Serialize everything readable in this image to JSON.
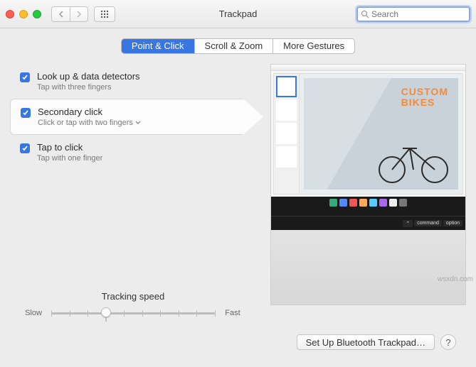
{
  "window": {
    "title": "Trackpad"
  },
  "search": {
    "placeholder": "Search"
  },
  "tabs": {
    "point_click": "Point & Click",
    "scroll_zoom": "Scroll & Zoom",
    "more_gestures": "More Gestures",
    "active": "point_click"
  },
  "options": [
    {
      "title": "Look up & data detectors",
      "subtitle": "Tap with three fingers",
      "checked": true,
      "has_dropdown": false
    },
    {
      "title": "Secondary click",
      "subtitle": "Click or tap with two fingers",
      "checked": true,
      "has_dropdown": true
    },
    {
      "title": "Tap to click",
      "subtitle": "Tap with one finger",
      "checked": true,
      "has_dropdown": false
    }
  ],
  "tracking": {
    "label": "Tracking speed",
    "min_label": "Slow",
    "max_label": "Fast",
    "ticks": 10,
    "value": 3
  },
  "preview": {
    "headline_line1": "CUSTOM",
    "headline_line2": "BIKES",
    "touchbar_keys": [
      "⌃",
      "command",
      "option"
    ]
  },
  "footer": {
    "setup_label": "Set Up Bluetooth Trackpad…",
    "help_label": "?"
  },
  "watermark": "wsxdn.com"
}
